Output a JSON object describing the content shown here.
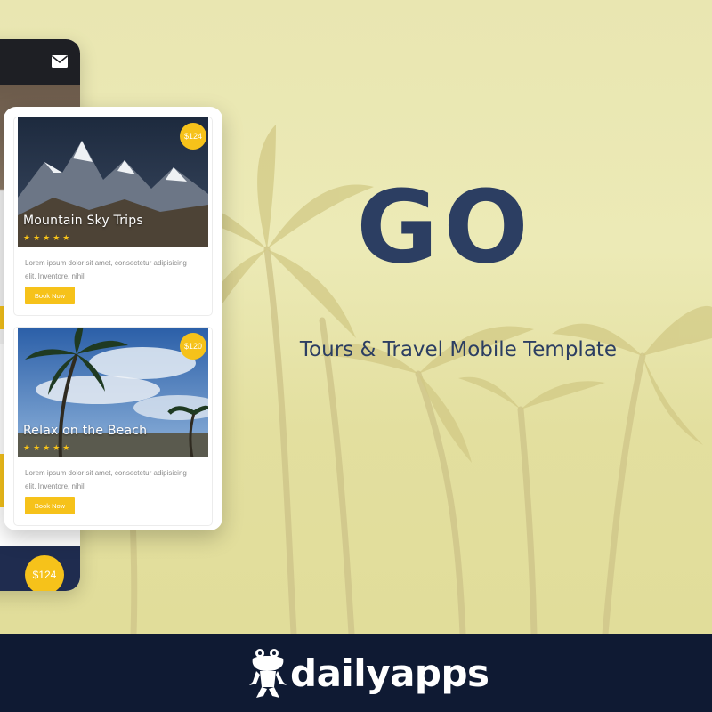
{
  "hero": {
    "title": "GO",
    "subtitle": "Tours & Travel Mobile Template"
  },
  "back_phone": {
    "icon": "mail-icon",
    "price": "$124"
  },
  "cards": [
    {
      "title": "Mountain Sky Trips",
      "price": "$124",
      "stars": "★★★★★",
      "rating": 5,
      "description": "Lorem ipsum dolor sit amet, consectetur adipisicing elit. Inventore, nihil",
      "button_label": "Book Now"
    },
    {
      "title": "Relax on the Beach",
      "price": "$120",
      "stars": "★★★★★",
      "rating": 5,
      "description": "Lorem ipsum dolor sit amet, consectetur adipisicing elit. Inventore, nihil",
      "button_label": "Book Now"
    }
  ],
  "footer": {
    "brand": "dailyapps",
    "icon": "frog-mascot-icon"
  },
  "colors": {
    "accent": "#f6c21a",
    "brand_navy": "#2c3e62",
    "footer_bg": "#0f1a33",
    "background": "#e9e6b1"
  }
}
